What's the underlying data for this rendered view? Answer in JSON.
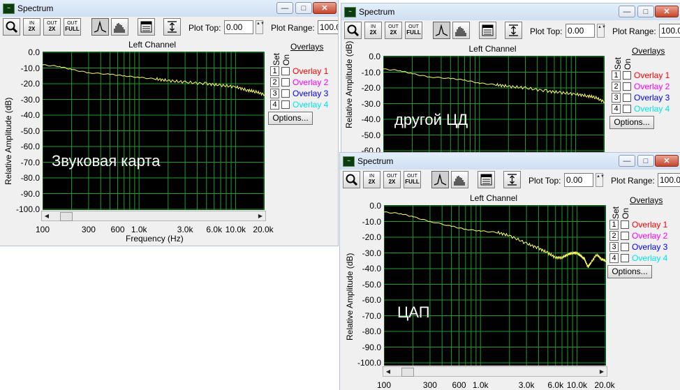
{
  "app": {
    "title": "Spectrum",
    "icon": "spectrum-app-icon"
  },
  "toolbar": {
    "zoom_in": [
      "IN",
      "2X"
    ],
    "zoom_out": [
      "OUT",
      "2X"
    ],
    "zoom_full": [
      "OUT",
      "FULL"
    ],
    "plot_top_label": "Plot Top:",
    "plot_top_value": "0.00",
    "plot_range_label": "Plot Range:",
    "plot_range_value": "100.0"
  },
  "chart_common": {
    "channel_title": "Left Channel",
    "ylabel": "Relative Amplitude (dB)",
    "xlabel": "Frequency (Hz)",
    "y_ticks": [
      "0.0",
      "-10.0",
      "-20.0",
      "-30.0",
      "-40.0",
      "-50.0",
      "-60.0",
      "-70.0",
      "-80.0",
      "-90.0",
      "-100.0"
    ],
    "x_ticks": [
      "100",
      "300",
      "600",
      "1.0k",
      "3.0k",
      "6.0k",
      "10.0k",
      "20.0k"
    ]
  },
  "overlays": {
    "title": "Overlays",
    "set_label": "Set",
    "on_label": "On",
    "items": [
      {
        "num": "1",
        "label": "Overlay 1",
        "color": "#ff0000"
      },
      {
        "num": "2",
        "label": "Overlay 2",
        "color": "#ff00ff"
      },
      {
        "num": "3",
        "label": "Overlay 3",
        "color": "#0000ff"
      },
      {
        "num": "4",
        "label": "Overlay 4",
        "color": "#00e5e5"
      }
    ],
    "options_label": "Options..."
  },
  "windows": [
    {
      "caption": "Звуковая карта"
    },
    {
      "caption": "другой ЦД"
    },
    {
      "caption": "ЦАП"
    }
  ],
  "chart_data": [
    {
      "type": "line",
      "xscale": "log",
      "xlim": [
        100,
        20000
      ],
      "ylim": [
        -100,
        0
      ],
      "grid": true,
      "line_color": "#ffff66",
      "series": [
        {
          "x": [
            100,
            150,
            200,
            300,
            500,
            700,
            1000,
            1500,
            2000,
            3000,
            5000,
            7000,
            10000,
            13000,
            16000,
            20000
          ],
          "y": [
            -8,
            -9,
            -11,
            -13,
            -14,
            -15,
            -16,
            -17,
            -18,
            -19,
            -20,
            -21,
            -22,
            -24,
            -25,
            -27
          ]
        }
      ]
    },
    {
      "type": "line",
      "xscale": "log",
      "xlim": [
        100,
        20000
      ],
      "ylim": [
        -100,
        0
      ],
      "grid": true,
      "line_color": "#ffff66",
      "series": [
        {
          "x": [
            100,
            150,
            200,
            300,
            500,
            700,
            1000,
            1500,
            2000,
            3000,
            5000,
            7000,
            10000,
            13000,
            16000,
            20000
          ],
          "y": [
            -8,
            -9,
            -11,
            -13,
            -14,
            -15,
            -17,
            -18,
            -19,
            -20,
            -22,
            -23,
            -24,
            -25,
            -26,
            -29
          ]
        }
      ]
    },
    {
      "type": "line",
      "xscale": "log",
      "xlim": [
        100,
        20000
      ],
      "ylim": [
        -100,
        0
      ],
      "grid": true,
      "line_color": "#ffff66",
      "series": [
        {
          "x": [
            100,
            150,
            200,
            300,
            500,
            700,
            1000,
            1500,
            2000,
            3000,
            4000,
            5000,
            6000,
            7000,
            8000,
            9000,
            10000,
            11000,
            12000,
            13000,
            14000,
            16000,
            18000,
            20000
          ],
          "y": [
            -4,
            -5,
            -7,
            -10,
            -13,
            -15,
            -16,
            -17,
            -19,
            -24,
            -27,
            -30,
            -33,
            -33,
            -31,
            -30,
            -30,
            -32,
            -34,
            -39,
            -36,
            -31,
            -34,
            -35
          ]
        }
      ]
    }
  ]
}
